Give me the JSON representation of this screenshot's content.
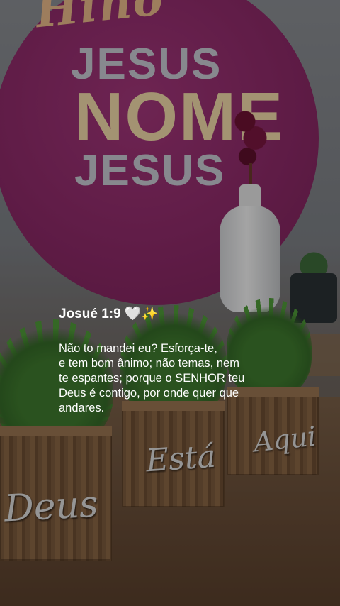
{
  "verse": {
    "reference": "Josué 1:9 🤍✨",
    "lines": [
      "Não to mandei eu? Esforça-te,",
      "e tem bom ânimo; não temas, nem",
      "te espantes; porque o SENHOR teu",
      "Deus é contigo, por onde quer que",
      "andares."
    ]
  },
  "background": {
    "plate_texts": [
      "Hino",
      "JESUS",
      "NOME",
      "JESUS"
    ],
    "box_labels": [
      "Deus",
      "Está",
      "Aqui"
    ]
  },
  "colors": {
    "plate": "#8d2a68",
    "overlay_text": "#ffffff",
    "wood": "#7b5a3d"
  }
}
